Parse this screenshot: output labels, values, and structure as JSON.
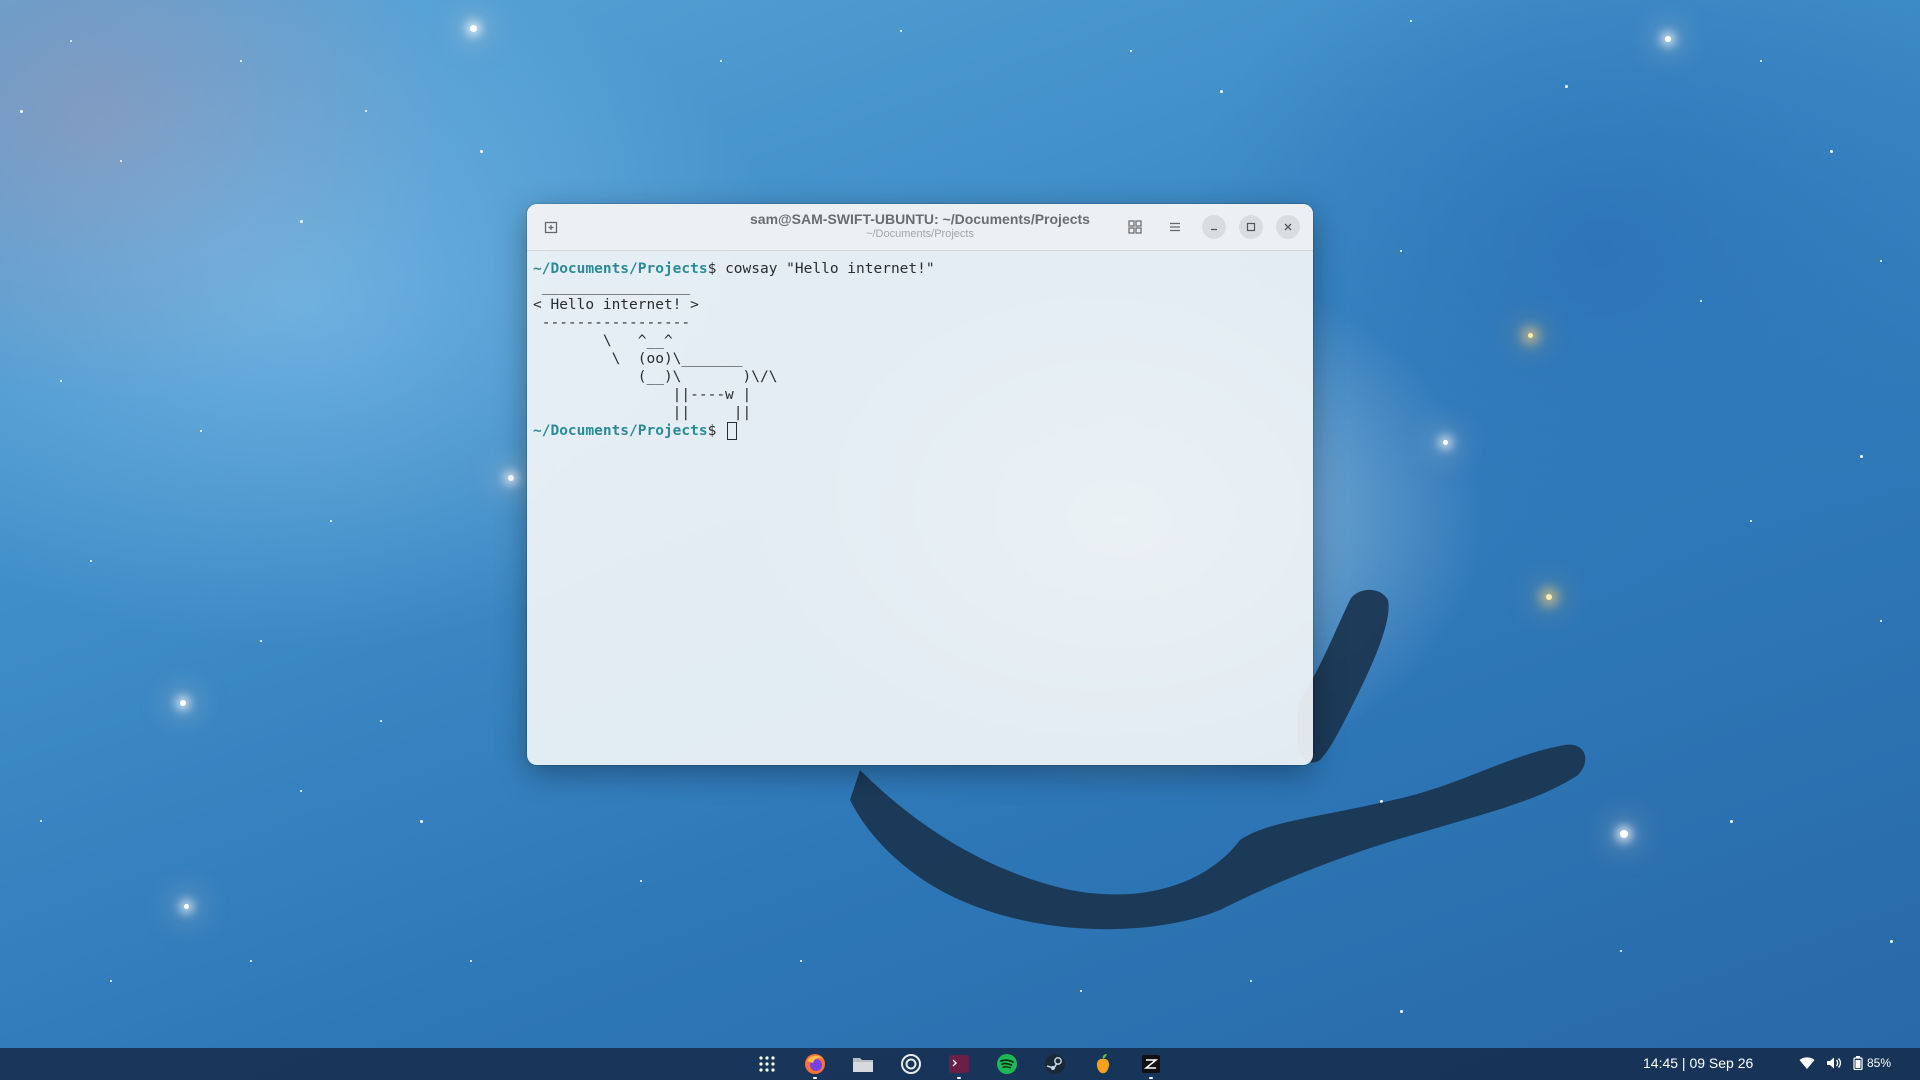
{
  "terminal": {
    "title": "sam@SAM-SWIFT-UBUNTU: ~/Documents/Projects",
    "subtitle": "~/Documents/Projects",
    "lines": [
      {
        "path": "~/Documents/Projects",
        "symbol": "$ ",
        "command": "cowsay \"Hello internet!\""
      },
      {
        "text": " _________________"
      },
      {
        "text": "< Hello internet! >"
      },
      {
        "text": " -----------------"
      },
      {
        "text": "        \\   ^__^"
      },
      {
        "text": "         \\  (oo)\\_______"
      },
      {
        "text": "            (__)\\       )\\/\\"
      },
      {
        "text": "                ||----w |"
      },
      {
        "text": "                ||     ||"
      },
      {
        "path": "~/Documents/Projects",
        "symbol": "$ ",
        "command": ""
      }
    ],
    "icons": {
      "new_tab": "new-tab-icon",
      "tile": "grid-icon",
      "menu": "hamburger-menu-icon",
      "minimize": "minimize-icon",
      "maximize": "maximize-icon",
      "close": "close-icon"
    }
  },
  "taskbar": {
    "apps": [
      {
        "name": "app-grid",
        "icon": "app-grid-icon"
      },
      {
        "name": "firefox",
        "icon": "firefox-icon",
        "running": true
      },
      {
        "name": "files",
        "icon": "folder-icon"
      },
      {
        "name": "settings",
        "icon": "settings-icon"
      },
      {
        "name": "terminal",
        "icon": "terminal-icon",
        "running": true
      },
      {
        "name": "spotify",
        "icon": "spotify-icon"
      },
      {
        "name": "steam",
        "icon": "steam-icon"
      },
      {
        "name": "fl-studio",
        "icon": "fruit-icon"
      },
      {
        "name": "zed",
        "icon": "zed-editor-icon",
        "running": true
      }
    ],
    "clock": "14:45 | 09 Sep 26",
    "battery": "85%",
    "colors": {
      "firefox": "#ff7139",
      "spotify": "#1db954",
      "terminal": "#6b1f46",
      "steam": "#1b2838",
      "files": "#9aa0a6"
    }
  }
}
